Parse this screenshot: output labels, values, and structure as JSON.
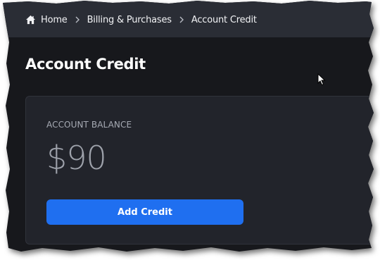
{
  "breadcrumb": {
    "items": [
      {
        "label": "Home",
        "icon": "home-icon"
      },
      {
        "label": "Billing & Purchases"
      },
      {
        "label": "Account Credit"
      }
    ]
  },
  "page": {
    "title": "Account Credit"
  },
  "balance_card": {
    "label": "ACCOUNT BALANCE",
    "value": "$90",
    "button_label": "Add Credit"
  },
  "colors": {
    "background": "#17181c",
    "breadcrumb_bar": "#2a2d35",
    "card": "#22242b",
    "accent": "#1f6ff0"
  }
}
